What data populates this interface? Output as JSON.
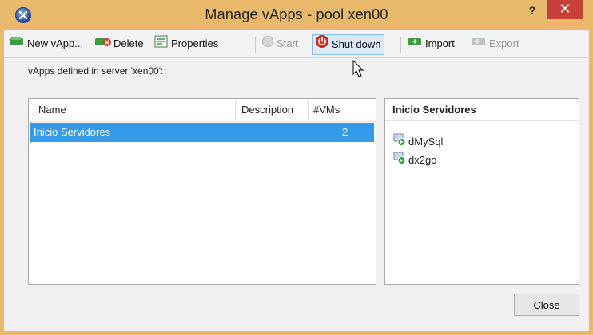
{
  "window": {
    "title": "Manage vApps - pool xen00",
    "help_label": "?",
    "close_label": "✕"
  },
  "toolbar": {
    "new_vapp": "New vApp...",
    "delete": "Delete",
    "properties": "Properties",
    "start": "Start",
    "shut_down": "Shut down",
    "import": "Import",
    "export": "Export"
  },
  "section_label": "vApps defined in server 'xen00':",
  "table": {
    "columns": [
      "Name",
      "Description",
      "#VMs"
    ],
    "rows": [
      {
        "name": "Inicio Servidores",
        "description": "",
        "vms": "2"
      }
    ]
  },
  "detail": {
    "title": "Inicio Servidores",
    "vms": [
      "dMySql",
      "dx2go"
    ]
  },
  "footer": {
    "close_button": "Close"
  },
  "colors": {
    "titlebar": "#e8b96a",
    "selection": "#3399e8",
    "close_red": "#c7403a"
  }
}
